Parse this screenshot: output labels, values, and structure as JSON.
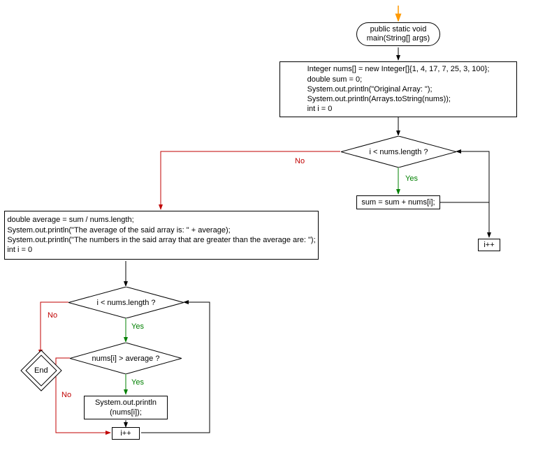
{
  "nodes": {
    "start": "public static void\nmain(String[] args)",
    "init": "Integer nums[] = new Integer[]{1, 4, 17, 7, 25, 3, 100};\ndouble sum = 0;\nSystem.out.println(\"Original Array: \");\nSystem.out.println(Arrays.toString(nums));\nint i = 0",
    "cond1": "i < nums.length ?",
    "sum": "sum = sum + nums[i];",
    "inc1": "i++",
    "avg": "double average = sum / nums.length;\nSystem.out.println(\"The average of the said array is: \" + average);\nSystem.out.println(\"The numbers in the said array that are greater than the average are: \");\nint i = 0",
    "cond2": "i < nums.length ?",
    "cond3": "nums[i] > average ?",
    "print": "System.out.println\n(nums[i]);",
    "inc2": "i++",
    "end": "End"
  },
  "labels": {
    "yes": "Yes",
    "no": "No"
  }
}
